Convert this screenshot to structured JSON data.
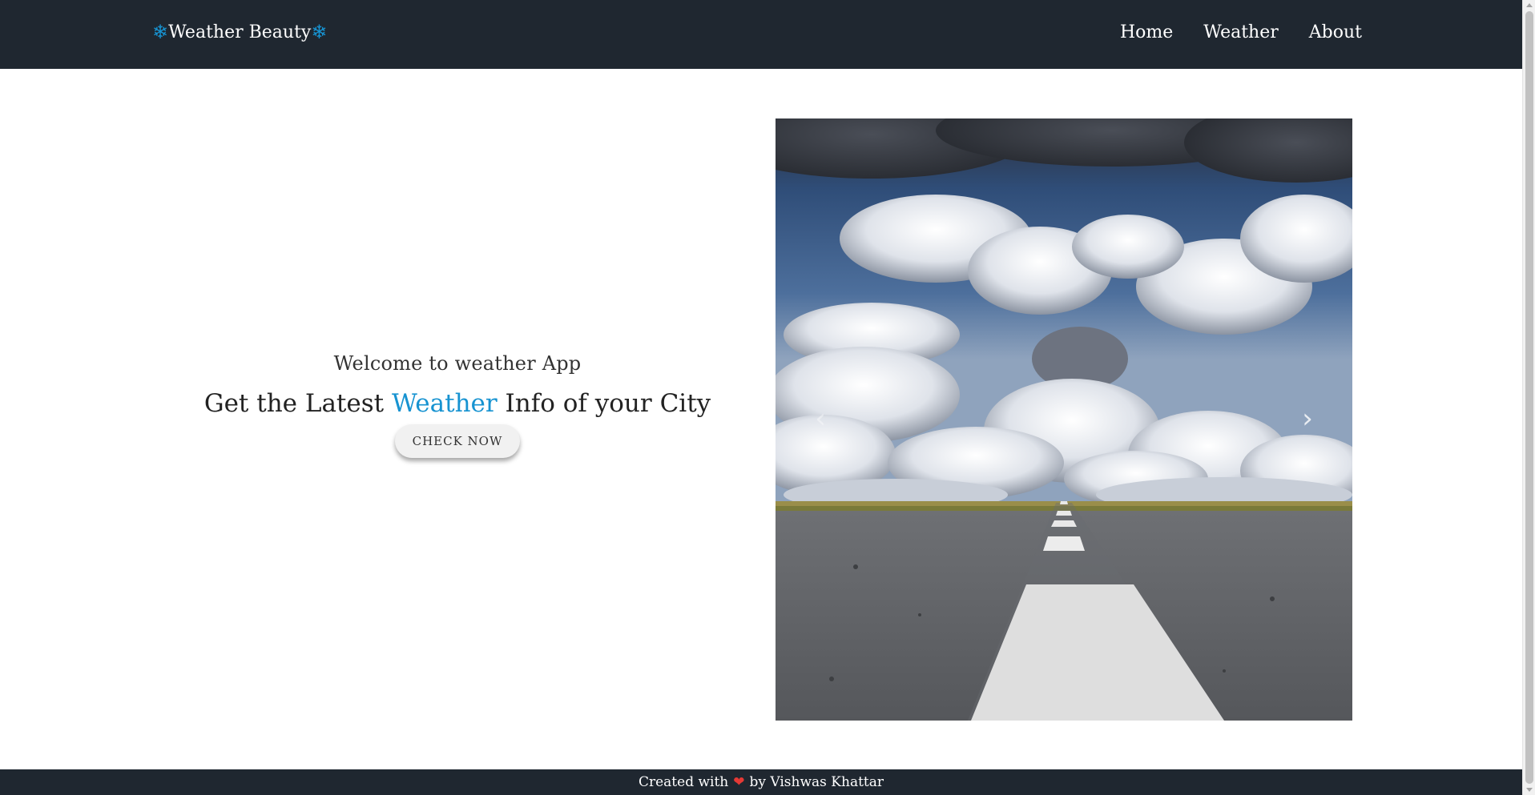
{
  "navbar": {
    "brand": {
      "icon": "snowflake-icon",
      "glyph": "❄",
      "label": "Weather Beauty"
    },
    "links": [
      "Home",
      "Weather",
      "About"
    ]
  },
  "hero": {
    "welcome": "Welcome to weather App",
    "title_before": "Get the Latest ",
    "title_accent": "Weather",
    "title_after": " Info of your City",
    "button_label": "CHECK NOW"
  },
  "carousel": {
    "image": "road-under-cloudy-sky",
    "prev_icon": "chevron-left-icon",
    "next_icon": "chevron-right-icon"
  },
  "footer": {
    "text_before": "Created with",
    "heart_icon": "heart-icon",
    "text_after": "by Vishwas Khattar"
  },
  "colors": {
    "navbar_bg": "#1f2730",
    "accent": "#1793d1",
    "heart": "#e53935"
  }
}
